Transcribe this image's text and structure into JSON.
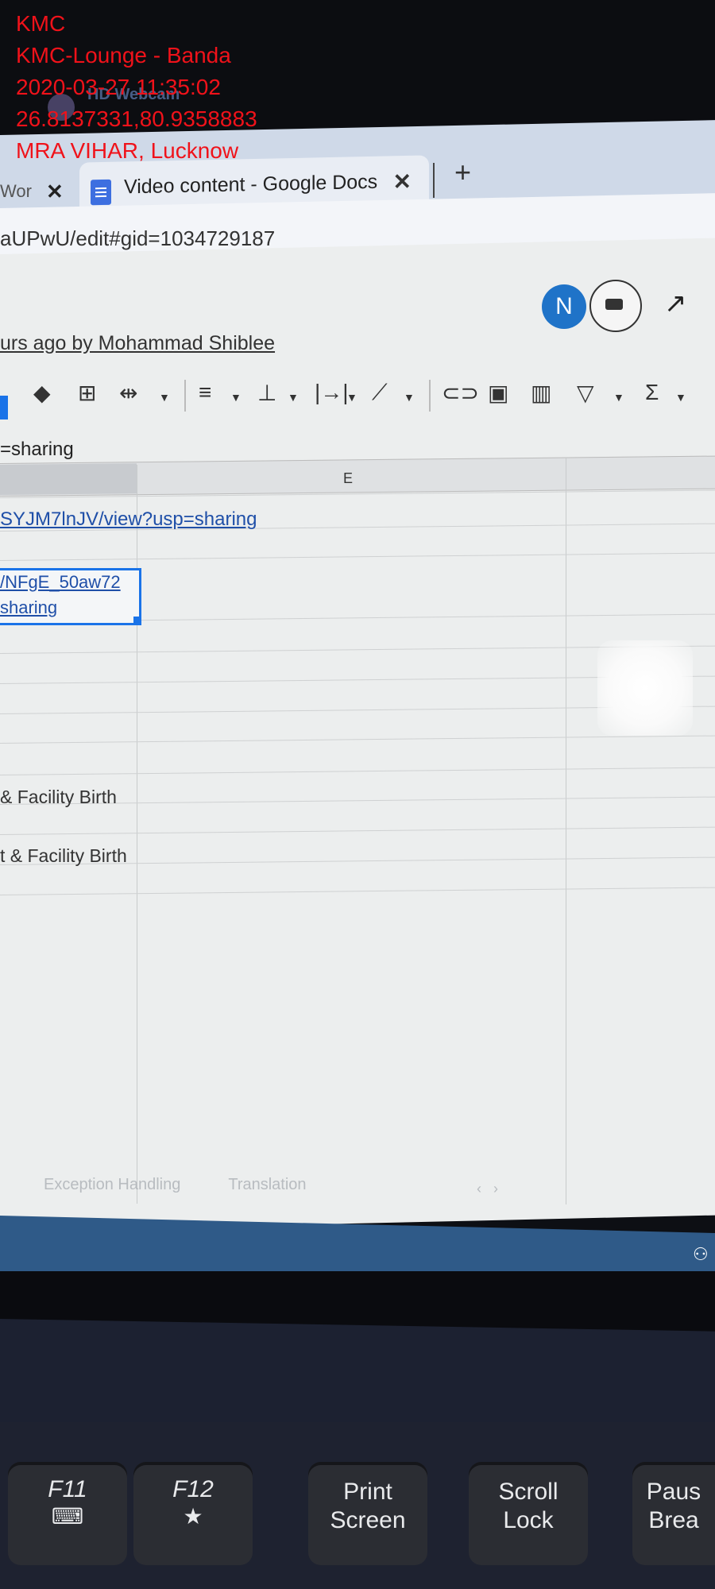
{
  "overlay": {
    "line1": "KMC",
    "line2": "KMC-Lounge - Banda",
    "line3": "2020-03-27 11:35:02",
    "line4": "26.8137331,80.9358883",
    "line5": "MRA VIHAR, Lucknow",
    "watermark": "HD Webcam"
  },
  "browser": {
    "tab_left_label": "Wor",
    "tab_left_close": "✕",
    "tab_active_title": "Video content - Google Docs",
    "tab_active_close": "✕",
    "new_tab": "+",
    "url": "aUPwU/edit#gid=1034729187"
  },
  "sheets": {
    "avatar_letter": "N",
    "last_edit": "urs ago by Mohammad Shiblee",
    "formula_bar": "=sharing",
    "column_header": "E",
    "link_row1": "SYJM7lnJV/view?usp=sharing",
    "link_row2_line1": "/NFgE_50aw72",
    "link_row2_line2": "sharing",
    "row_text_1": "&  Facility Birth",
    "row_text_2": "t & Facility Birth",
    "sheet_tab_1": "Exception Handling",
    "sheet_tab_2": "Translation",
    "toolbar_icons": [
      "paint-format-icon",
      "borders-icon",
      "merge-cells-icon",
      "align-left-icon",
      "vertical-align-icon",
      "text-wrap-icon",
      "text-rotate-icon",
      "insert-link-icon",
      "insert-comment-icon",
      "insert-chart-icon",
      "filter-icon",
      "functions-icon"
    ]
  },
  "keyboard": {
    "f11_label": "F11",
    "f11_sub": "⌨",
    "f12_label": "F12",
    "f12_sub": "★",
    "print_l1": "Print",
    "print_l2": "Screen",
    "scroll_l1": "Scroll",
    "scroll_l2": "Lock",
    "pause_l1": "Paus",
    "pause_l2": "Brea"
  }
}
